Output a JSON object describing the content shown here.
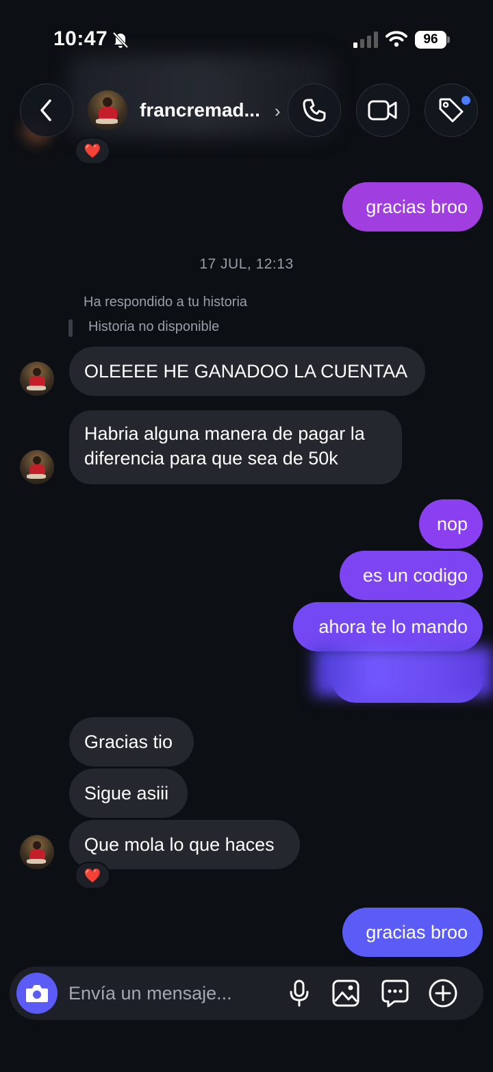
{
  "status_bar": {
    "time": "10:47",
    "battery": "96"
  },
  "header": {
    "contact_name": "francremad...",
    "chevron": "›"
  },
  "icons": {
    "back": "chevron-left-icon",
    "call": "phone-icon",
    "video": "video-camera-icon",
    "tag": "tag-icon",
    "camera": "camera-icon",
    "mic": "microphone-icon",
    "gallery": "image-icon",
    "sticker": "chat-bubble-icon",
    "plus": "plus-circle-icon"
  },
  "colors": {
    "background": "#0c0f14",
    "incoming_bubble": "#25272f",
    "outgoing_gradient_top": "#a03ee0",
    "outgoing_gradient_bottom": "#5b5bf5",
    "reaction_heart": "#ff2d45",
    "notification_dot": "#4d7dff"
  },
  "reactions": {
    "heart": "❤️"
  },
  "messages": {
    "top_outgoing": "gracias broo",
    "timestamp": "17 JUL, 12:13",
    "reply_note": "Ha respondido a tu historia",
    "reply_story": "Historia no disponible",
    "incoming_1": "OLEEEE HE GANADOO LA CUENTAA",
    "incoming_2": "Habria alguna manera de pagar la diferencia para que sea de 50k",
    "outgoing_1": "nop",
    "outgoing_2": "es un codigo",
    "outgoing_3": "ahora te lo mando",
    "incoming_3": "Gracias tio",
    "incoming_4": "Sigue asiii",
    "incoming_5": "Que mola lo que haces",
    "outgoing_4": "gracias broo"
  },
  "composer": {
    "placeholder": "Envía un mensaje..."
  }
}
